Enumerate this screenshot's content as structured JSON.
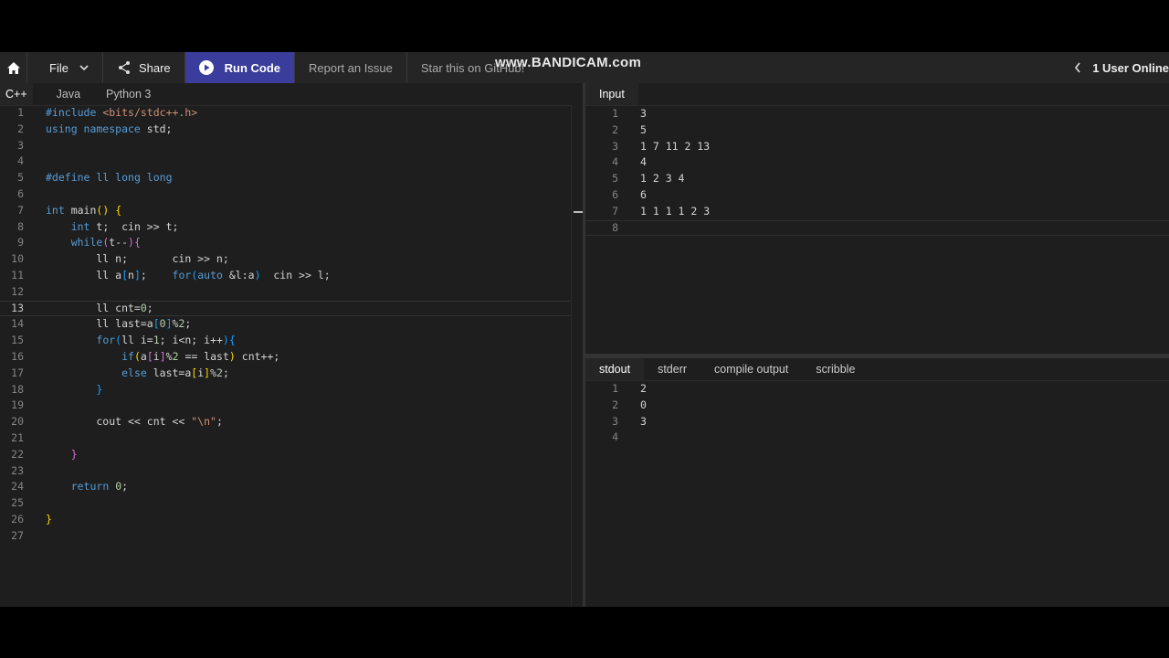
{
  "watermark": "www.BANDICAM.com",
  "toolbar": {
    "file": "File",
    "share": "Share",
    "run": "Run Code",
    "report": "Report an Issue",
    "star": "Star this on GitHub!",
    "users": "1 User Online"
  },
  "lang_tabs": [
    "C++",
    "Java",
    "Python 3"
  ],
  "editor": {
    "current_line": 13,
    "line_numbers": [
      "1",
      "2",
      "3",
      "4",
      "5",
      "6",
      "7",
      "8",
      "9",
      "10",
      "11",
      "12",
      "13",
      "14",
      "15",
      "16",
      "17",
      "18",
      "19",
      "20",
      "21",
      "22",
      "23",
      "24",
      "25",
      "26",
      "27"
    ]
  },
  "input": {
    "tab": "Input",
    "line_numbers": [
      "1",
      "2",
      "3",
      "4",
      "5",
      "6",
      "7",
      "8"
    ],
    "lines": [
      "3",
      "5",
      "1 7 11 2 13",
      "4",
      "1 2 3 4",
      "6",
      "1 1 1 1 2 3",
      ""
    ]
  },
  "output": {
    "tabs": [
      "stdout",
      "stderr",
      "compile output",
      "scribble"
    ],
    "line_numbers": [
      "1",
      "2",
      "3",
      "4"
    ],
    "lines": [
      "2",
      "0",
      "3",
      ""
    ]
  },
  "colors": {
    "run_button": "#3a3d9b",
    "background": "#1e1e1e",
    "keyword": "#569cd6"
  }
}
